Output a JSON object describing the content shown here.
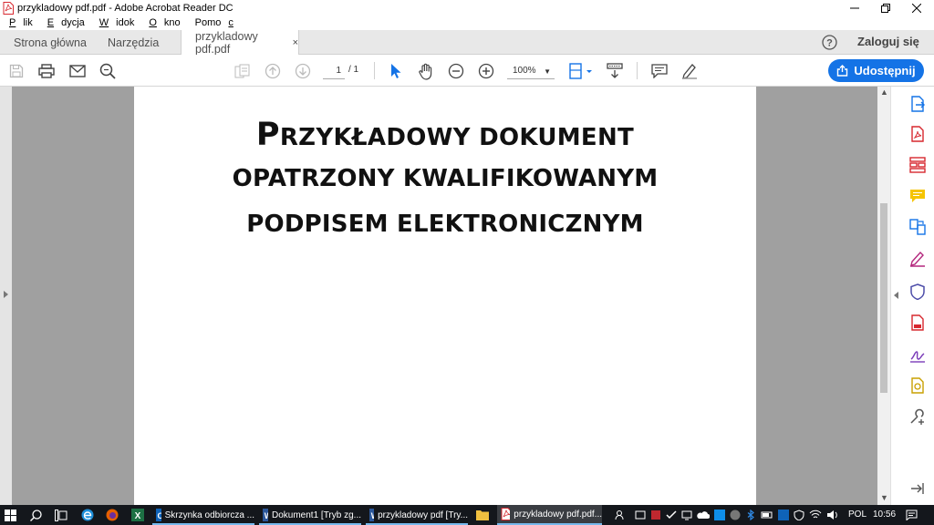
{
  "window": {
    "title": "przykladowy pdf.pdf - Adobe Acrobat Reader DC"
  },
  "menu": {
    "items": [
      {
        "first": "P",
        "rest": "lik"
      },
      {
        "first": "E",
        "rest": "dycja"
      },
      {
        "first": "W",
        "rest": "idok"
      },
      {
        "first": "O",
        "rest": "kno"
      },
      {
        "first": "",
        "rest": "Pomo",
        "underlined_last": "c"
      }
    ]
  },
  "tabs": {
    "home": "Strona główna",
    "tools": "Narzędzia",
    "document": "przykladowy pdf.pdf",
    "close": "×"
  },
  "header": {
    "login": "Zaloguj się",
    "share": "Udostępnij"
  },
  "toolbar": {
    "page_current": "1",
    "page_total": "/ 1",
    "zoom": "100%"
  },
  "document": {
    "line1_initial": "P",
    "line1_rest": "RZYKŁADOWY DOKUMENT",
    "line2": "OPATRZONY KWALIFIKOWANYM",
    "line3": "PODPISEM ELEKTRONICZNYM"
  },
  "taskbar": {
    "apps": [
      {
        "label": "Skrzynka odbiorcza ...",
        "icon": "outlook-icon"
      },
      {
        "label": "Dokument1 [Tryb zg...",
        "icon": "word-icon"
      },
      {
        "label": "przykladowy pdf [Try...",
        "icon": "word-icon"
      },
      {
        "label": "przykladowy pdf.pdf...",
        "icon": "acrobat-icon"
      }
    ],
    "language": "POL",
    "time": "10:56"
  },
  "colors": {
    "accent": "#1473e6",
    "acrobat_red": "#d7282f",
    "doc_background": "#a0a0a0",
    "taskbar": "#14171c"
  }
}
